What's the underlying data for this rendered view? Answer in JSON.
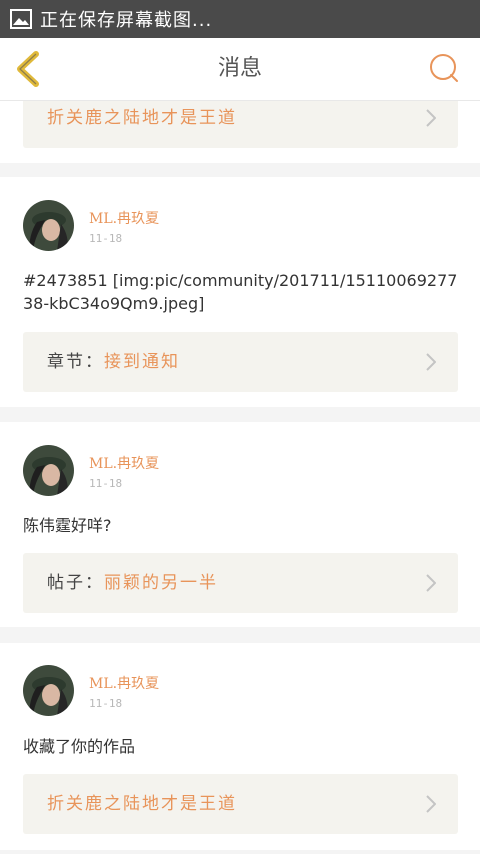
{
  "statusbar": {
    "text": "正在保存屏幕截图..."
  },
  "header": {
    "title": "消息",
    "back_icon": "chevron-left-icon",
    "search_icon": "search-icon"
  },
  "colors": {
    "accent": "#e8945a",
    "back_icon": "#e0b93a",
    "ref_bg": "#f4f3ee"
  },
  "feed": {
    "top_partial": {
      "ref_value": "折关鹿之陆地才是王道"
    },
    "items": [
      {
        "user": "ML.冉玖夏",
        "date": "11-18",
        "text": "#2473851 [img:pic/community/201711/1511006927738-kbC34o9Qm9.jpeg]",
        "ref_label": "章节：",
        "ref_value": "接到通知"
      },
      {
        "user": "ML.冉玖夏",
        "date": "11-18",
        "text": "陈伟霆好咩?",
        "ref_label": "帖子：",
        "ref_value": "丽颖的另一半"
      },
      {
        "user": "ML.冉玖夏",
        "date": "11-18",
        "text": "收藏了你的作品",
        "ref_label": "",
        "ref_value": "折关鹿之陆地才是王道"
      }
    ]
  }
}
